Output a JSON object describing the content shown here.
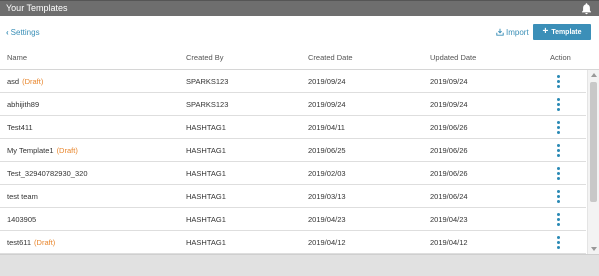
{
  "window": {
    "title": "Your Templates"
  },
  "toolbar": {
    "settings_label": "Settings",
    "import_label": "Import",
    "template_button_label": "Template"
  },
  "table": {
    "columns": [
      "Name",
      "Created By",
      "Created Date",
      "Updated Date",
      "Action"
    ],
    "rows": [
      {
        "name": "asd",
        "draft": "(Draft)",
        "created_by": "SPARKS123",
        "created": "2019/09/24",
        "updated": "2019/09/24"
      },
      {
        "name": "abhijith89",
        "draft": "",
        "created_by": "SPARKS123",
        "created": "2019/09/24",
        "updated": "2019/09/24"
      },
      {
        "name": "Test411",
        "draft": "",
        "created_by": "HASHTAG1",
        "created": "2019/04/11",
        "updated": "2019/06/26"
      },
      {
        "name": "My Template1",
        "draft": "(Draft)",
        "created_by": "HASHTAG1",
        "created": "2019/06/25",
        "updated": "2019/06/26"
      },
      {
        "name": "Test_32940782930_320",
        "draft": "",
        "created_by": "HASHTAG1",
        "created": "2019/02/03",
        "updated": "2019/06/26"
      },
      {
        "name": "test team",
        "draft": "",
        "created_by": "HASHTAG1",
        "created": "2019/03/13",
        "updated": "2019/06/24"
      },
      {
        "name": "1403905",
        "draft": "",
        "created_by": "HASHTAG1",
        "created": "2019/04/23",
        "updated": "2019/04/23"
      },
      {
        "name": "test611",
        "draft": "(Draft)",
        "created_by": "HASHTAG1",
        "created": "2019/04/12",
        "updated": "2019/04/12"
      }
    ]
  },
  "icons": {
    "bell": "bell-icon",
    "back": "chevron-left-icon",
    "import": "import-icon",
    "add": "plus-icon",
    "action": "kebab-menu-icon"
  },
  "colors": {
    "titlebar": "#6e6e6e",
    "accent": "#3b8fb8",
    "draft": "#e8852b"
  }
}
